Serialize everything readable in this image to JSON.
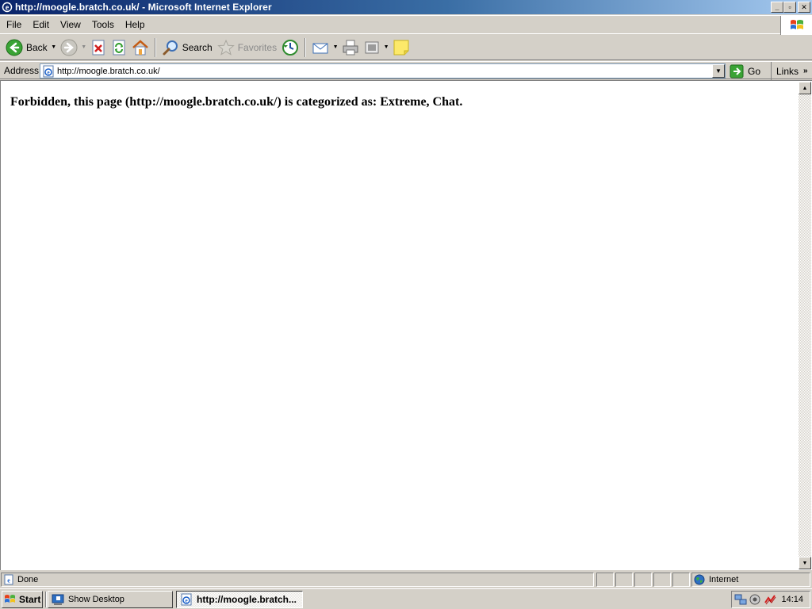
{
  "window": {
    "title": "http://moogle.bratch.co.uk/ - Microsoft Internet Explorer",
    "caption_min": "_",
    "caption_max": "▫",
    "caption_close": "✕"
  },
  "menu": {
    "file": "File",
    "edit": "Edit",
    "view": "View",
    "tools": "Tools",
    "help": "Help"
  },
  "toolbar": {
    "back": "Back",
    "search": "Search",
    "favorites": "Favorites"
  },
  "address": {
    "label": "Address",
    "url": "http://moogle.bratch.co.uk/",
    "go": "Go",
    "links": "Links"
  },
  "page": {
    "message": "Forbidden, this page (http://moogle.bratch.co.uk/) is categorized as: Extreme, Chat."
  },
  "status": {
    "text": "Done",
    "zone": "Internet"
  },
  "taskbar": {
    "start": "Start",
    "show_desktop": "Show Desktop",
    "ie_task": "http://moogle.bratch...",
    "clock": "14:14"
  },
  "icons": {
    "ie": "internet-explorer-icon",
    "back": "back-arrow-icon",
    "forward": "forward-arrow-icon",
    "stop": "stop-icon",
    "refresh": "refresh-icon",
    "home": "home-icon",
    "search": "search-icon",
    "favorites": "favorites-star-icon",
    "history": "history-icon",
    "mail": "mail-icon",
    "print": "print-icon",
    "edit": "edit-icon",
    "messenger": "note-icon"
  },
  "colors": {
    "titlebar_start": "#0a246a",
    "titlebar_end": "#a6caf0",
    "chrome": "#d4d0c8"
  }
}
